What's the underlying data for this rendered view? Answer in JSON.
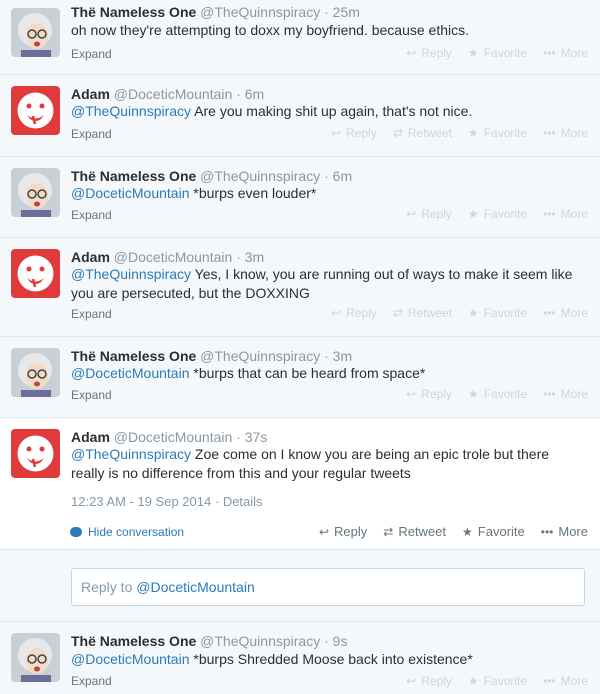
{
  "actions": {
    "reply": "Reply",
    "retweet": "Retweet",
    "favorite": "Favorite",
    "more": "More",
    "expand": "Expand"
  },
  "tweets": [
    {
      "fullname": "Thë Nameless One",
      "username": "@TheQuinnspiracy",
      "sep": "·",
      "time": "25m",
      "mention": "",
      "text": "oh now they're attempting to doxx my boyfriend. because ethics.",
      "avatar": "grandma"
    },
    {
      "fullname": "Adam",
      "username": "@DoceticMountain",
      "sep": "·",
      "time": "6m",
      "mention": "@TheQuinnspiracy",
      "text": " Are you making shit up again, that's not nice.",
      "avatar": "redface"
    },
    {
      "fullname": "Thë Nameless One",
      "username": "@TheQuinnspiracy",
      "sep": "·",
      "time": "6m",
      "mention": "@DoceticMountain",
      "text": " *burps even louder*",
      "avatar": "grandma"
    },
    {
      "fullname": "Adam",
      "username": "@DoceticMountain",
      "sep": "·",
      "time": "3m",
      "mention": "@TheQuinnspiracy",
      "text": " Yes, I know, you are running out of ways to make it seem like you are persecuted, but the DOXXING",
      "avatar": "redface"
    },
    {
      "fullname": "Thë Nameless One",
      "username": "@TheQuinnspiracy",
      "sep": "·",
      "time": "3m",
      "mention": "@DoceticMountain",
      "text": " *burps that can be heard from space*",
      "avatar": "grandma"
    },
    {
      "fullname": "Adam",
      "username": "@DoceticMountain",
      "sep": "·",
      "time": "37s",
      "mention": "@TheQuinnspiracy",
      "text": " Zoe come on I know you are being an epic trole but there really is no difference from this and your regular tweets",
      "avatar": "redface"
    },
    {
      "fullname": "Thë Nameless One",
      "username": "@TheQuinnspiracy",
      "sep": "·",
      "time": "9s",
      "mention": "@DoceticMountain",
      "text": " *burps Shredded Moose back into existence*",
      "avatar": "grandma"
    }
  ],
  "open_tweet": {
    "timestamp": "12:23 AM - 19 Sep 2014",
    "details_sep": "·",
    "details": "Details",
    "hide_conversation": "Hide conversation"
  },
  "reply_box": {
    "prefix": "Reply to ",
    "mention": "@DoceticMountain"
  },
  "colors": {
    "link": "#2b7bb9",
    "muted": "#8899a6",
    "bg": "#f5f8fa"
  }
}
